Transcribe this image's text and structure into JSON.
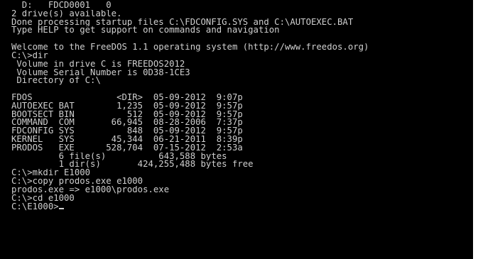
{
  "terminal": {
    "lines": [
      "  D:   FDCD0001   0",
      "2 drive(s) available.",
      "Done processing startup files C:\\FDCONFIG.SYS and C:\\AUTOEXEC.BAT",
      "Type HELP to get support on commands and navigation",
      "",
      "Welcome to the FreeDOS 1.1 operating system (http://www.freedos.org)",
      "C:\\>dir",
      " Volume in drive C is FREEDOS2012",
      " Volume Serial Number is 0D38-1CE3",
      " Directory of C:\\",
      "",
      "FDOS                <DIR>  05-09-2012  9:07p",
      "AUTOEXEC BAT        1,235  05-09-2012  9:57p",
      "BOOTSECT BIN          512  05-09-2012  9:57p",
      "COMMAND  COM       66,945  08-28-2006  7:37p",
      "FDCONFIG SYS          848  05-09-2012  9:57p",
      "KERNEL   SYS       45,344  06-21-2011  8:39p",
      "PRODOS   EXE      528,704  07-15-2012  2:53a",
      "         6 file(s)          643,588 bytes",
      "         1 dir(s)       424,255,488 bytes free",
      "C:\\>mkdir E1000",
      "C:\\>copy prodos.exe e1000",
      "prodos.exe => e1000\\prodos.exe",
      "C:\\>cd e1000",
      "C:\\E1000>"
    ]
  },
  "colors": {
    "background": "#000000",
    "foreground": "#cfcfcf"
  }
}
